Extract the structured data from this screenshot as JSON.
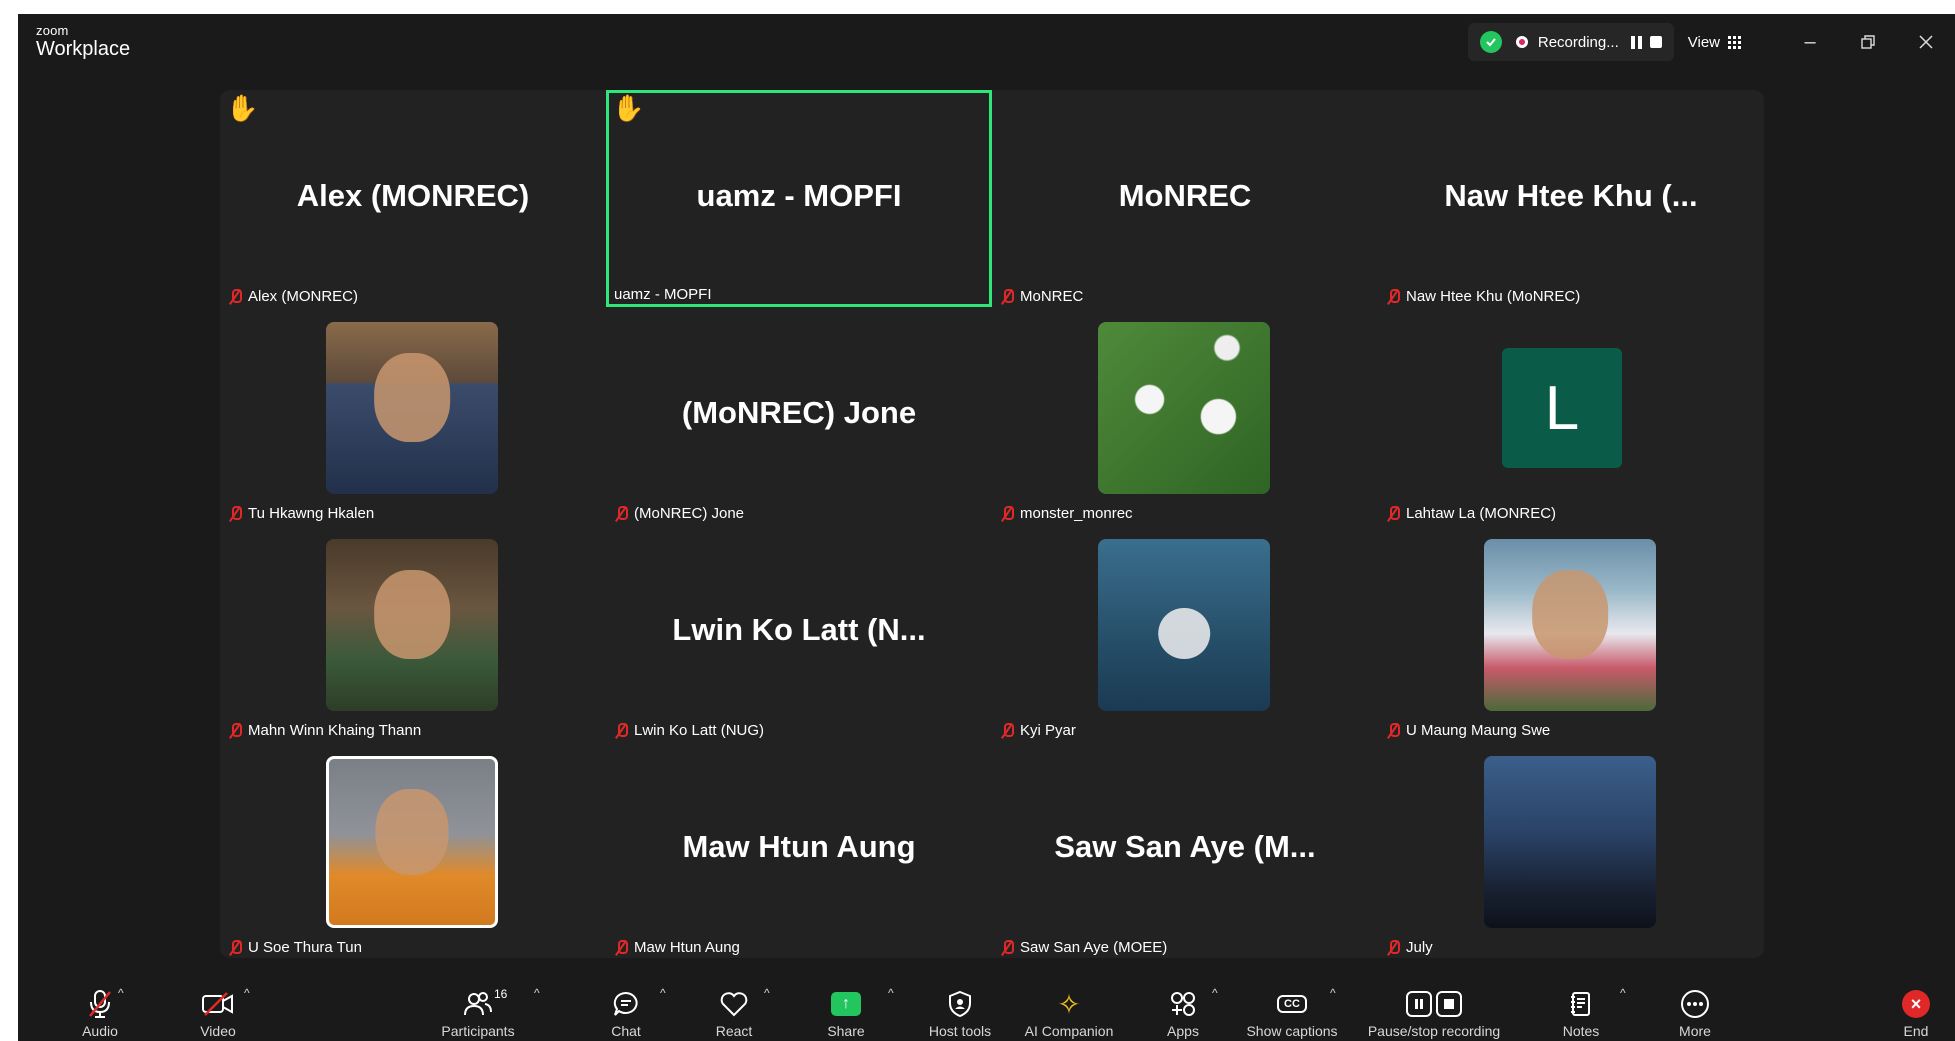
{
  "titlebar": {
    "logo_small": "zoom",
    "logo_big": "Workplace",
    "recording_label": "Recording...",
    "view_label": "View"
  },
  "participants_grid": [
    {
      "big_name": "Alex (MONREC)",
      "label": "Alex (MONREC)",
      "hand": "✋"
    },
    {
      "big_name": "uamz - MOPFI",
      "label": "uamz - MOPFI",
      "hand": "✋"
    },
    {
      "big_name": "MoNREC",
      "label": "MoNREC"
    },
    {
      "big_name": "Naw Htee Khu (...",
      "label": "Naw Htee Khu (MoNREC)"
    },
    {
      "label": "Tu Hkawng Hkalen"
    },
    {
      "big_name": "(MoNREC) Jone",
      "label": "(MoNREC) Jone"
    },
    {
      "label": "monster_monrec"
    },
    {
      "avatar_letter": "L",
      "label": "Lahtaw La (MONREC)"
    },
    {
      "label": "Mahn Winn Khaing Thann"
    },
    {
      "big_name": "Lwin Ko Latt (N...",
      "label": "Lwin Ko Latt (NUG)"
    },
    {
      "label": "Kyi Pyar"
    },
    {
      "label": "U Maung Maung Swe"
    },
    {
      "label": "U Soe Thura Tun"
    },
    {
      "big_name": "Maw Htun Aung",
      "label": "Maw Htun Aung"
    },
    {
      "big_name": "Saw San Aye (M...",
      "label": "Saw San Aye (MOEE)"
    },
    {
      "label": "July"
    }
  ],
  "toolbar": {
    "audio": "Audio",
    "video": "Video",
    "participants": "Participants",
    "participants_count": "16",
    "chat": "Chat",
    "react": "React",
    "share": "Share",
    "host_tools": "Host tools",
    "ai_companion": "AI Companion",
    "apps": "Apps",
    "show_captions": "Show captions",
    "pause_stop": "Pause/stop recording",
    "notes": "Notes",
    "more": "More",
    "end": "End"
  },
  "colors": {
    "active_speaker": "#2ee679",
    "share": "#23c55e",
    "end": "#e02828",
    "avatar_letter_bg": "#0a5b47"
  }
}
